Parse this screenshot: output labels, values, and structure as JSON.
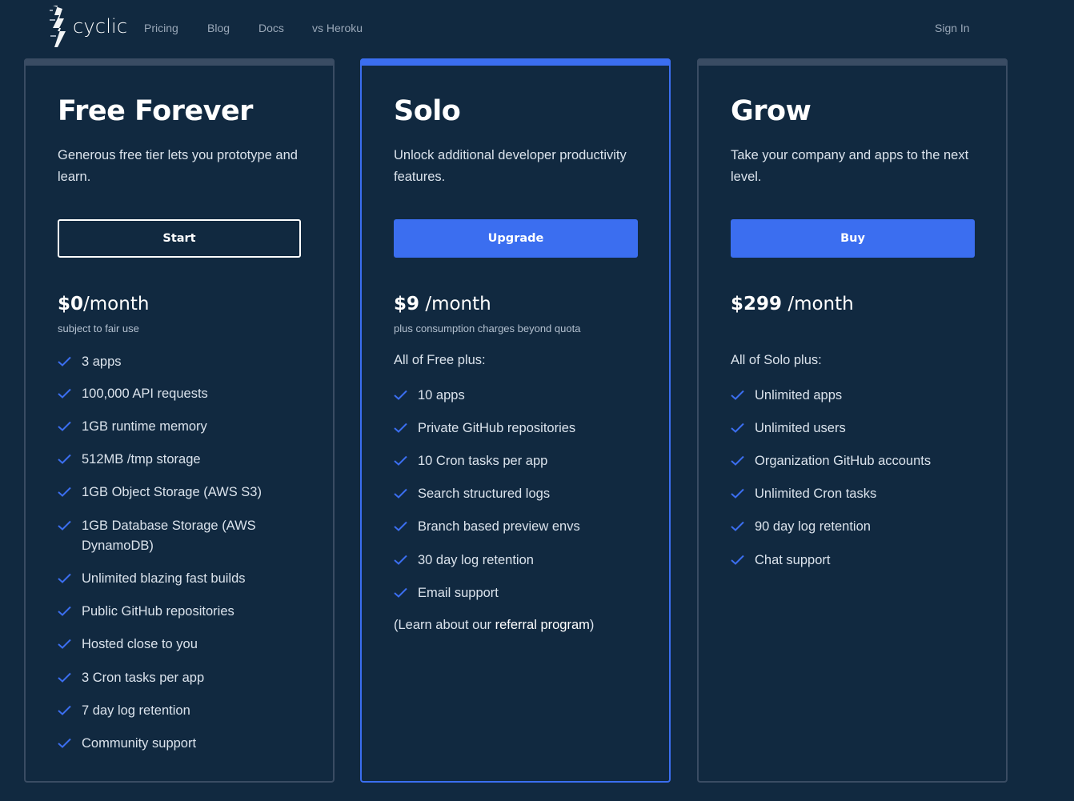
{
  "brand": {
    "name": "cyclic"
  },
  "nav": {
    "links": [
      "Pricing",
      "Blog",
      "Docs",
      "vs Heroku"
    ],
    "signin": "Sign In"
  },
  "plans": [
    {
      "title": "Free Forever",
      "description": "Generous free tier lets you prototype and learn.",
      "cta": "Start",
      "price_amount": "$0",
      "price_period": "/month",
      "price_note": "subject to fair use",
      "features": [
        "3 apps",
        "100,000 API requests",
        "1GB runtime memory",
        "512MB /tmp storage",
        "1GB Object Storage (AWS S3)",
        "1GB Database Storage (AWS DynamoDB)",
        "Unlimited blazing fast builds",
        "Public GitHub repositories",
        "Hosted close to you",
        "3 Cron tasks per app",
        "7 day log retention",
        "Community support"
      ]
    },
    {
      "title": "Solo",
      "description": "Unlock additional developer productivity features.",
      "cta": "Upgrade",
      "price_amount": "$9",
      "price_period": " /month",
      "price_note": "plus consumption charges beyond quota",
      "intro": "All of Free plus:",
      "features": [
        "10 apps",
        "Private GitHub repositories",
        "10 Cron tasks per app",
        "Search structured logs",
        "Branch based preview envs",
        "30 day log retention",
        "Email support"
      ],
      "referral_prefix": "(Learn about our ",
      "referral_link": "referral program",
      "referral_suffix": ")"
    },
    {
      "title": "Grow",
      "description": "Take your company and apps to the next level.",
      "cta": "Buy",
      "price_amount": "$299",
      "price_period": " /month",
      "intro": "All of Solo plus:",
      "features": [
        "Unlimited apps",
        "Unlimited users",
        "Organization GitHub accounts",
        "Unlimited Cron tasks",
        "90 day log retention",
        "Chat support"
      ]
    }
  ],
  "colors": {
    "background": "#112940",
    "accent": "#3b6ef0",
    "card_border": "#3a4c63",
    "check": "#3b6ef0"
  },
  "icons": {
    "check": "check-icon",
    "logo": "cyclic-logo-icon"
  }
}
